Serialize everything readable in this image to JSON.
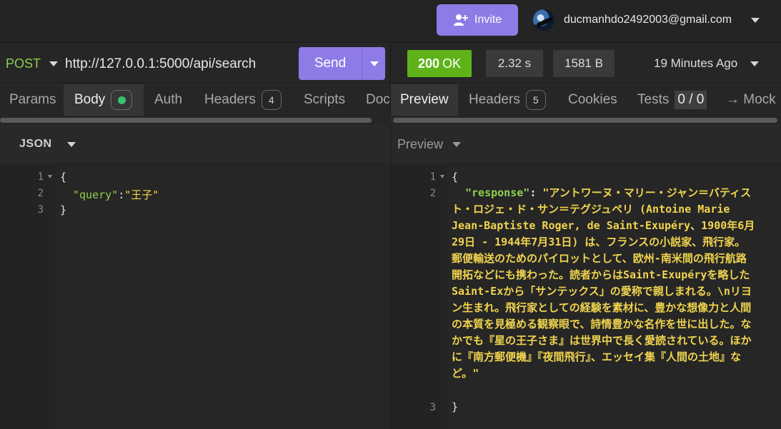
{
  "header": {
    "invite_label": "Invite",
    "account_email": "ducmanhdo2492003@gmail.com"
  },
  "request": {
    "method": "POST",
    "url": "http://127.0.0.1:5000/api/search",
    "send_label": "Send",
    "tabs": [
      {
        "label": "Params"
      },
      {
        "label": "Body"
      },
      {
        "label": "Auth"
      },
      {
        "label": "Headers",
        "count": "4"
      },
      {
        "label": "Scripts"
      },
      {
        "label": "Doc"
      }
    ],
    "body_format": "JSON",
    "body_lines": [
      "1",
      "2",
      "3"
    ],
    "body": {
      "open_brace": "{",
      "key": "\"query\"",
      "colon": ":",
      "value": "\"王子\"",
      "close_brace": "}"
    }
  },
  "response": {
    "status_code": "200",
    "status_text": "OK",
    "time": "2.32 s",
    "size": "1581 B",
    "when": "19 Minutes Ago",
    "tabs": [
      {
        "label": "Preview"
      },
      {
        "label": "Headers",
        "count": "5"
      },
      {
        "label": "Cookies"
      },
      {
        "label": "Tests",
        "count": "0 / 0"
      },
      {
        "label": "→ Mock"
      }
    ],
    "preview_label": "Preview",
    "lines": [
      "1",
      "2",
      "3"
    ],
    "open_brace": "{",
    "key": "\"response\"",
    "colon": ": ",
    "value": "\"アントワーヌ・マリー・ジャン＝バティスト・ロジェ・ド・サン＝テグジュペリ (Antoine Marie Jean-Baptiste Roger, de Saint-Exupéry、1900年6月29日 - 1944年7月31日) は、フランスの小説家、飛行家。郵便輸送のためのパイロットとして、欧州-南米間の飛行航路開拓などにも携わった。読者からはSaint-Exupéryを略したSaint-Exから「サンテックス」の愛称で親しまれる。\\nリヨン生まれ。飛行家としての経験を素材に、豊かな想像力と人間の本質を見極める観察眼で、詩情豊かな名作を世に出した。なかでも『星の王子さま』は世界中で長く愛読されている。ほかに『南方郵便機』『夜間飛行』、エッセイ集『人間の土地』など。\"",
    "close_brace": "}"
  },
  "colors": {
    "accent": "#8f7be6",
    "status_ok": "#5fb319",
    "json_key": "#8ed04e",
    "json_string": "#f0d44e",
    "method": "#8ed04e"
  }
}
